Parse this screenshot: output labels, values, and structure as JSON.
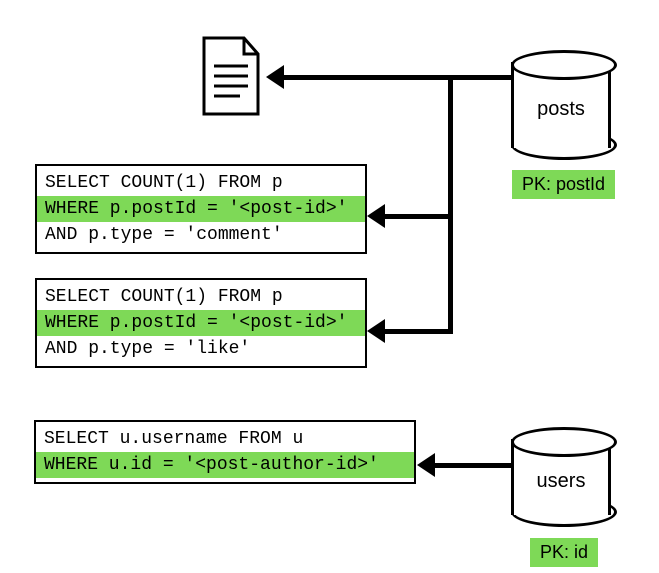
{
  "databases": {
    "posts": {
      "label": "posts",
      "pk": "PK: postId"
    },
    "users": {
      "label": "users",
      "pk": "PK: id"
    }
  },
  "queries": {
    "count_comments": {
      "line1": "SELECT COUNT(1) FROM p",
      "line2": "WHERE p.postId = '<post-id>'",
      "line3": "AND p.type = 'comment'"
    },
    "count_likes": {
      "line1": "SELECT COUNT(1) FROM p",
      "line2": "WHERE p.postId = '<post-id>'",
      "line3": "AND p.type = 'like'"
    },
    "username": {
      "line1": "SELECT u.username FROM u",
      "line2": "WHERE u.id = '<post-author-id>'"
    }
  }
}
